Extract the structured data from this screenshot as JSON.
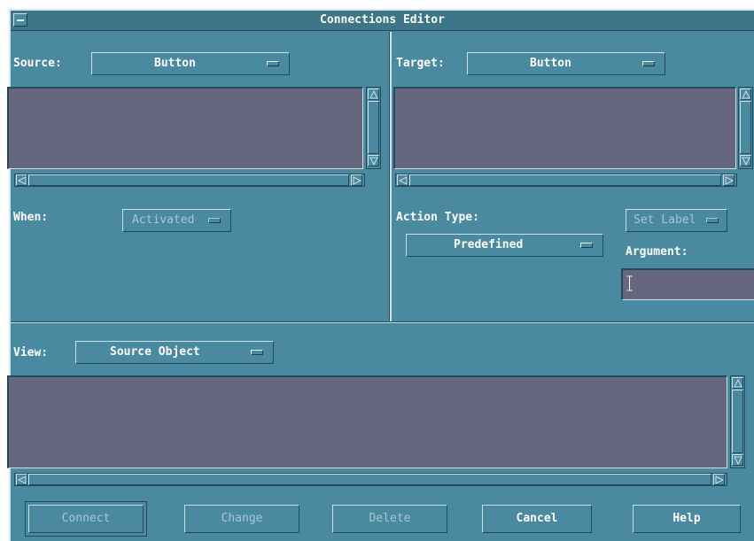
{
  "window": {
    "title": "Connections Editor"
  },
  "source": {
    "label": "Source:",
    "value": "Button"
  },
  "target": {
    "label": "Target:",
    "value": "Button"
  },
  "when": {
    "label": "When:",
    "value": "Activated"
  },
  "action": {
    "label": "Action Type:",
    "value": "Predefined",
    "setlabel": "Set Label"
  },
  "argument": {
    "label": "Argument:",
    "value": ""
  },
  "view": {
    "label": "View:",
    "value": "Source Object"
  },
  "buttons": {
    "connect": "Connect",
    "change": "Change",
    "delete": "Delete",
    "cancel": "Cancel",
    "help": "Help"
  },
  "colors": {
    "background": "#4a8aa0",
    "list": "#66677f",
    "title": "#3c7688",
    "disabled_text": "#a7c7d1"
  },
  "icons": [
    "window-menu-icon",
    "option-menu-indicator-icon",
    "scroll-up-arrow-icon",
    "scroll-down-arrow-icon",
    "scroll-left-arrow-icon",
    "scroll-right-arrow-icon",
    "text-cursor-icon"
  ]
}
